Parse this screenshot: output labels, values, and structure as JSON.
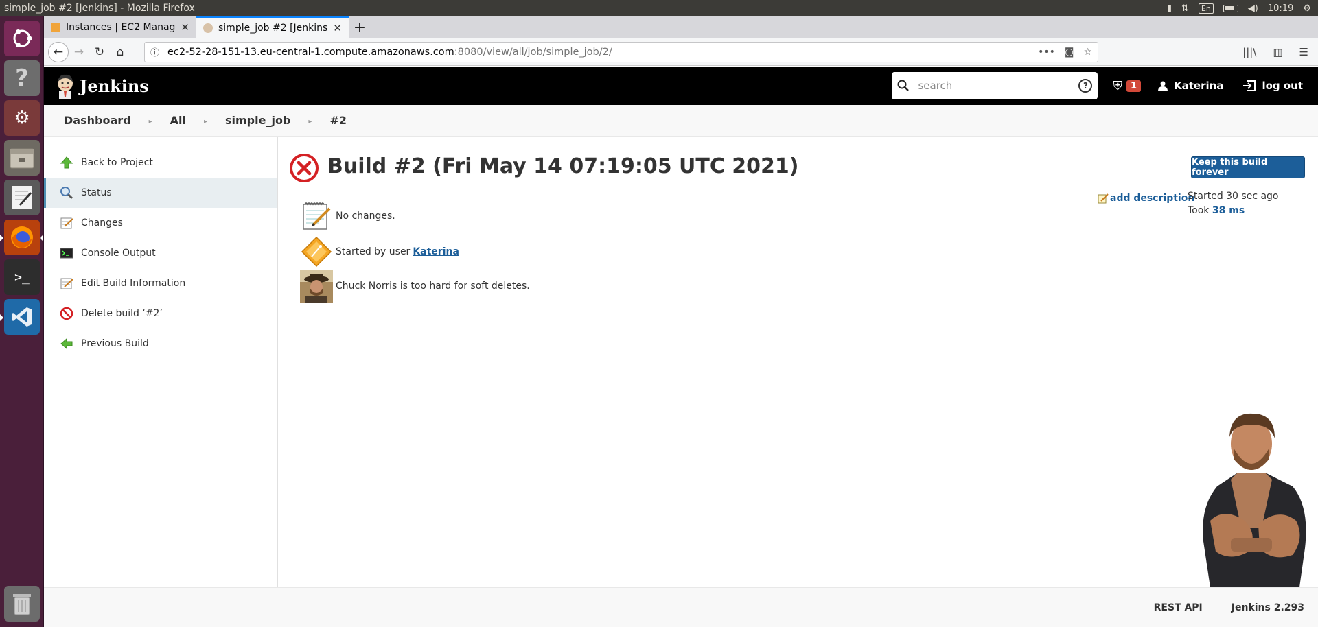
{
  "os": {
    "window_title": "simple_job #2 [Jenkins] - Mozilla Firefox",
    "keyboard_layout": "En",
    "clock": "10:19"
  },
  "launcher": {
    "items": [
      "ubuntu-icon",
      "help-icon",
      "settings-icon",
      "files-icon",
      "text-editor-icon",
      "firefox-icon",
      "terminal-icon",
      "vscode-icon",
      "trash-icon"
    ]
  },
  "browser": {
    "tabs": [
      {
        "label": "Instances | EC2 Manager",
        "active": false
      },
      {
        "label": "simple_job #2 [Jenkins]",
        "active": true
      }
    ],
    "url_host": "ec2-52-28-151-13.eu-central-1.compute.amazonaws.com",
    "url_path": ":8080/view/all/job/simple_job/2/"
  },
  "jenkins": {
    "title": "Jenkins",
    "search_placeholder": "search",
    "alert_count": "1",
    "user_name": "Katerina",
    "logout_label": "log out"
  },
  "breadcrumb": {
    "items": [
      "Dashboard",
      "All",
      "simple_job",
      "#2"
    ]
  },
  "sidebar": {
    "items": [
      {
        "label": "Back to Project",
        "icon": "up-arrow-icon"
      },
      {
        "label": "Status",
        "icon": "magnifier-icon",
        "active": true
      },
      {
        "label": "Changes",
        "icon": "notepad-icon"
      },
      {
        "label": "Console Output",
        "icon": "terminal-icon"
      },
      {
        "label": "Edit Build Information",
        "icon": "notepad-icon"
      },
      {
        "label": "Delete build ‘#2’",
        "icon": "no-entry-icon"
      },
      {
        "label": "Previous Build",
        "icon": "left-arrow-icon"
      }
    ]
  },
  "build": {
    "title": "Build #2 (Fri May 14 07:19:05 UTC 2021)",
    "status": "failed",
    "keep_button": "Keep this build forever",
    "add_description": "add description",
    "started_label": "Started 30 sec ago",
    "took_label": "Took",
    "took_value": "38 ms",
    "summary": {
      "no_changes": "No changes.",
      "started_by_prefix": "Started by user",
      "started_by_user": "Katerina",
      "chuck_fact": "Chuck Norris is too hard for soft deletes."
    }
  },
  "footer": {
    "rest_api": "REST API",
    "version": "Jenkins 2.293"
  },
  "colors": {
    "header_bg": "#000000",
    "accent_blue": "#1c5e99",
    "failed_red": "#d42124",
    "launcher_bg": "#4a1f3a"
  }
}
